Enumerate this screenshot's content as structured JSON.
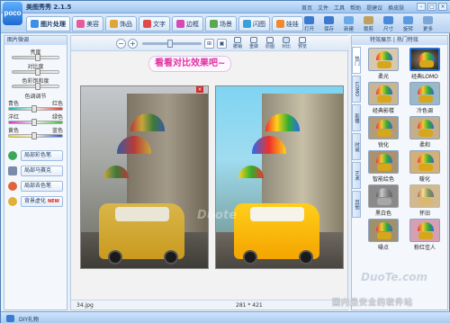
{
  "app": {
    "title": "美图秀秀 2.1.5",
    "logo": "poco"
  },
  "top_menu": [
    "首页",
    "文件",
    "工具",
    "帮助",
    "提建议",
    "换皮肤"
  ],
  "tabs": [
    {
      "label": "图片处理",
      "color": "#3d8ee8"
    },
    {
      "label": "美容",
      "color": "#e85a9c"
    },
    {
      "label": "饰品",
      "color": "#e0a43a"
    },
    {
      "label": "文字",
      "color": "#e04a4a"
    },
    {
      "label": "边框",
      "color": "#d54ab5"
    },
    {
      "label": "场景",
      "color": "#5aa84e"
    },
    {
      "label": "闪图",
      "color": "#3aa0d8"
    },
    {
      "label": "娃娃",
      "color": "#f08a2a"
    }
  ],
  "right_tools": [
    {
      "label": "打开",
      "color": "#3a7ad0"
    },
    {
      "label": "保存",
      "color": "#3a7ad0"
    },
    {
      "label": "新建",
      "color": "#6aa9e8"
    },
    {
      "label": "裁剪",
      "color": "#c0a060"
    },
    {
      "label": "尺寸",
      "color": "#4a8ad8"
    },
    {
      "label": "旋转",
      "color": "#5a9ae0"
    },
    {
      "label": "更多",
      "color": "#7aa6d8"
    }
  ],
  "left": {
    "header": "图片微调",
    "brightness": "亮度",
    "contrast": "对比度",
    "saturation": "色彩饱和度",
    "color_header": "色调调节",
    "cyan": "青色",
    "red": "红色",
    "magenta": "洋红",
    "green": "绿色",
    "yellow": "黄色",
    "blue": "蓝色",
    "buttons": [
      {
        "label": "局部彩色笔",
        "color": "#3aa85a"
      },
      {
        "label": "局部马赛克",
        "color": "#7a8aa8"
      },
      {
        "label": "局部去色笔",
        "color": "#e0643a"
      },
      {
        "label": "背景虚化",
        "color": "#e0b03a",
        "badge": "NEW"
      }
    ]
  },
  "center": {
    "zoom_out": "−",
    "zoom_in": "+",
    "actions": [
      "撤销",
      "重做",
      "原图",
      "对比",
      "预览"
    ],
    "banner": "看看对比效果吧~",
    "filename": "34.jpg",
    "dimensions": "281 * 421",
    "watermark": "Duote"
  },
  "right": {
    "header": "特效展示 | 热门特效",
    "vtabs": [
      "热门",
      "LOMO",
      "影楼",
      "时尚",
      "艺术",
      "其他"
    ],
    "effects": [
      "柔光",
      "经典LOMO",
      "经典影楼",
      "冷色调",
      "锐化",
      "柔和",
      "智能绘色",
      "暖化",
      "黑白色",
      "怀旧",
      "噪点",
      "粉红佳人"
    ]
  },
  "statusbar": {
    "text": "DIY礼物"
  },
  "watermarks": {
    "site": "DuoTe.com",
    "brand": "国内最安全的软件站"
  }
}
